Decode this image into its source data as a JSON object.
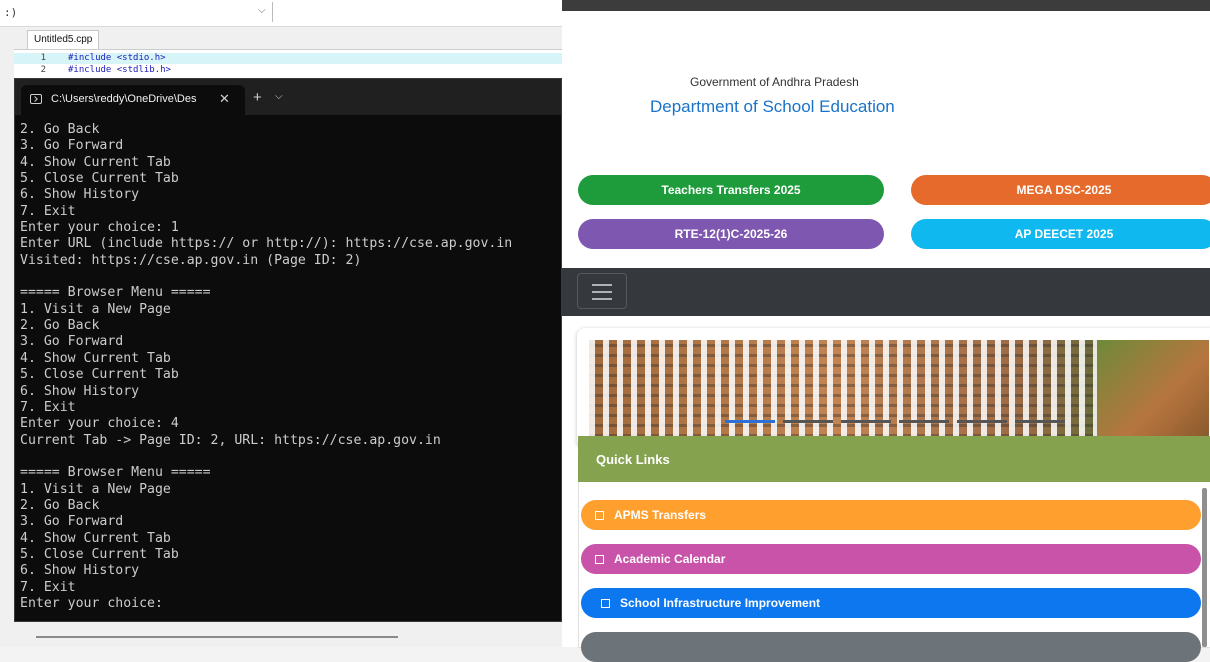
{
  "ide": {
    "combo_text": ":)",
    "combo_arrow": "⌵",
    "tab_label": "Untitled5.cpp",
    "lines": [
      {
        "num": "1",
        "code": "#include <stdio.h>"
      },
      {
        "num": "2",
        "code": "#include <stdlib.h>"
      }
    ]
  },
  "terminal": {
    "tab_title": "C:\\Users\\reddy\\OneDrive\\Des",
    "close_glyph": "✕",
    "new_tab_glyph": "+",
    "dropdown_glyph": "⌵",
    "lines": [
      "2. Go Back",
      "3. Go Forward",
      "4. Show Current Tab",
      "5. Close Current Tab",
      "6. Show History",
      "7. Exit",
      "Enter your choice: 1",
      "Enter URL (include https:// or http://): https://cse.ap.gov.in",
      "Visited: https://cse.ap.gov.in (Page ID: 2)",
      "",
      "===== Browser Menu =====",
      "1. Visit a New Page",
      "2. Go Back",
      "3. Go Forward",
      "4. Show Current Tab",
      "5. Close Current Tab",
      "6. Show History",
      "7. Exit",
      "Enter your choice: 4",
      "Current Tab -> Page ID: 2, URL: https://cse.ap.gov.in",
      "",
      "===== Browser Menu =====",
      "1. Visit a New Page",
      "2. Go Back",
      "3. Go Forward",
      "4. Show Current Tab",
      "5. Close Current Tab",
      "6. Show History",
      "7. Exit",
      "Enter your choice:"
    ]
  },
  "website": {
    "gov_label": "Government of Andhra Pradesh",
    "dept_title": "Department of School Education",
    "buttons": {
      "teachers": {
        "label": "Teachers Transfers 2025",
        "color": "#1e9b3b"
      },
      "mega": {
        "label": "MEGA DSC-2025",
        "color": "#e56a2c"
      },
      "rte": {
        "label": "RTE-12(1)C-2025-26",
        "color": "#7e57b0"
      },
      "deecet": {
        "label": "AP DEECET 2025",
        "color": "#10b8f0"
      }
    },
    "quick_links": {
      "title": "Quick Links",
      "items": [
        {
          "label": "APMS Transfers",
          "color": "#ff9f2e"
        },
        {
          "label": "Academic Calendar",
          "color": "#c853a8"
        },
        {
          "label": "School Infrastructure Improvement",
          "color": "#0d77f0"
        }
      ]
    },
    "colors": {
      "navbar": "#35393e",
      "quick_links_header": "#85a24f",
      "indicator_active": "#2b70d6",
      "indicator": "#555555"
    }
  }
}
